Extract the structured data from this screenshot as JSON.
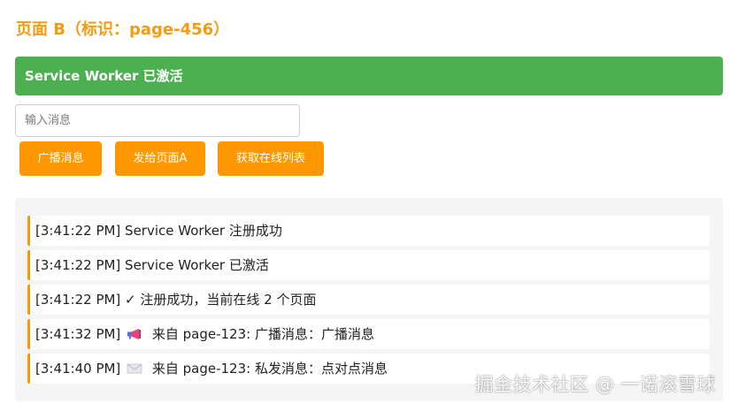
{
  "page_title": "页面 B（标识：page-456）",
  "status": "Service Worker 已激活",
  "input": {
    "placeholder": "输入消息",
    "value": ""
  },
  "buttons": {
    "broadcast": "广播消息",
    "send_to_a": "发给页面A",
    "online_list": "获取在线列表"
  },
  "log": [
    {
      "text": "[3:41:22 PM] Service Worker 注册成功",
      "icon": ""
    },
    {
      "text": "[3:41:22 PM] Service Worker 已激活",
      "icon": ""
    },
    {
      "text": "[3:41:22 PM] ✓ 注册成功，当前在线 2 个页面",
      "icon": ""
    },
    {
      "time": "[3:41:32 PM]",
      "icon": "megaphone-icon",
      "message": "来自 page-123: 广播消息：广播消息"
    },
    {
      "time": "[3:41:40 PM]",
      "icon": "envelope-icon",
      "message": "来自 page-123: 私发消息：点对点消息"
    }
  ],
  "watermark": "掘金技术社区 @ 一诺滚雪球",
  "colors": {
    "accent_orange": "#ff9800",
    "title_orange": "#f39c12",
    "status_green": "#4caf50",
    "log_background": "#f5f5f5"
  }
}
